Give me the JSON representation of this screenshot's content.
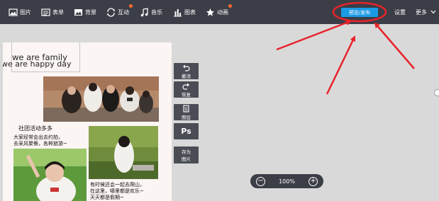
{
  "toolbar": {
    "items": [
      {
        "label": "图片",
        "icon": "image-icon"
      },
      {
        "label": "表单",
        "icon": "form-icon"
      },
      {
        "label": "背景",
        "icon": "background-icon"
      },
      {
        "label": "互动",
        "icon": "interact-icon"
      },
      {
        "label": "音乐",
        "icon": "music-icon"
      },
      {
        "label": "图表",
        "icon": "chart-icon"
      },
      {
        "label": "动画",
        "icon": "star-icon"
      }
    ],
    "publish_label": "预览/发布",
    "settings_label": "设置",
    "more_label": "更多"
  },
  "poster": {
    "title_line1": "we are family",
    "title_line2": "we are happy day",
    "section_title": "社团活动多多",
    "caption_left": [
      "大家经常会出去约拍，",
      "去采风聚餐，各种旅游~"
    ],
    "caption_right": [
      "有时候还会一起去爬山，",
      "在这里，哪里都是欢乐~",
      "天天都是假期~"
    ]
  },
  "side_tools": [
    {
      "label": "撤消",
      "icon": "undo-icon"
    },
    {
      "label": "恢复",
      "icon": "redo-icon"
    },
    {
      "label": "图层",
      "icon": "layers-icon"
    },
    {
      "label": "Ps",
      "icon": "ps-icon"
    },
    {
      "label": "存为图片",
      "line1": "存为",
      "line2": "图片",
      "icon": "save-image-icon"
    }
  ],
  "zoom": {
    "level": "100%",
    "minus": "−",
    "plus": "+"
  },
  "colors": {
    "toolbar": "#3b3e46",
    "publish": "#1b9ae6",
    "annotation": "#e8232b",
    "canvas": "#d9d9d9"
  }
}
